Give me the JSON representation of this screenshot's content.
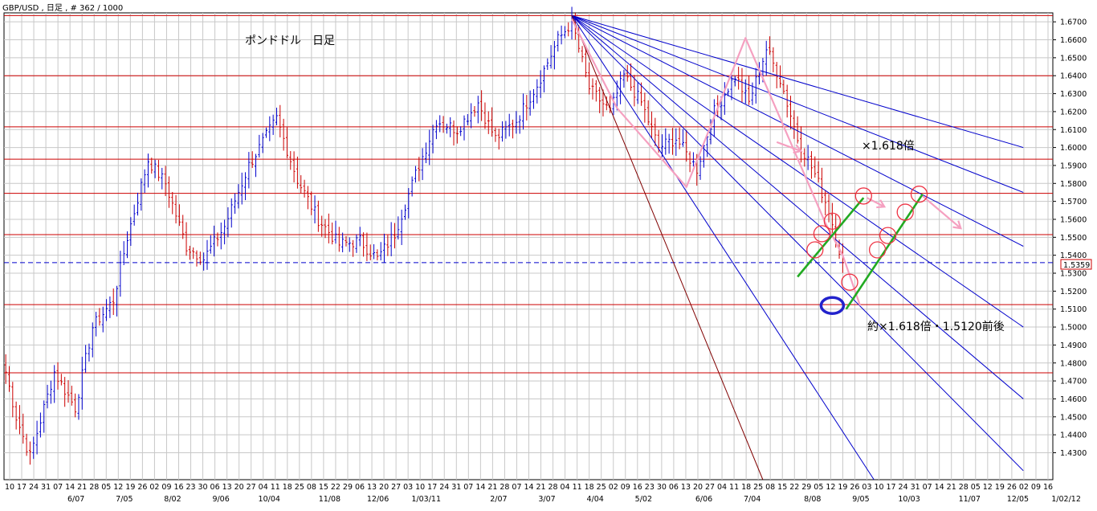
{
  "header": {
    "symbol_info": "GBP/USD , 日足 , # 362 / 1000"
  },
  "chart_title": "ポンドドル　日足",
  "annotations": {
    "fib_upper": "×1.618倍",
    "fib_lower": "約×1.618倍・1.5120前後"
  },
  "last_price_label": "1.5359",
  "colors": {
    "background": "#ffffff",
    "grid": "#c8c8c8",
    "bull": "#0000cc",
    "bear": "#cc0000",
    "fan": "#0000cc",
    "fan_steep": "#800000",
    "zone_lines": "#cc0000",
    "current_price": "#0000cc",
    "pattern": "#f5a0c0",
    "channel": "#22aa22",
    "circle": "#ee3344",
    "target_ring": "#2222cc"
  },
  "chart_data": {
    "type": "candlestick",
    "symbol": "GBP/USD",
    "timeframe": "日足",
    "ylim": [
      1.415,
      1.675
    ],
    "y_ticks": [
      "1.6700",
      "1.6600",
      "1.6500",
      "1.6400",
      "1.6300",
      "1.6200",
      "1.6100",
      "1.6000",
      "1.5900",
      "1.5800",
      "1.5700",
      "1.5600",
      "1.5500",
      "1.5400",
      "1.5300",
      "1.5200",
      "1.5100",
      "1.5000",
      "1.4900",
      "1.4800",
      "1.4700",
      "1.4600",
      "1.4500",
      "1.4400",
      "1.4300"
    ],
    "x_day_labels": [
      "10",
      "17",
      "24",
      "31",
      "07",
      "14",
      "21",
      "28",
      "05",
      "12",
      "19",
      "26",
      "02",
      "09",
      "16",
      "23",
      "30",
      "06",
      "13",
      "20",
      "27",
      "04",
      "11",
      "18",
      "25",
      "08",
      "15",
      "22",
      "29",
      "06",
      "13",
      "20",
      "27",
      "03",
      "10",
      "17",
      "24",
      "31",
      "07",
      "14",
      "21",
      "28",
      "07",
      "14",
      "21",
      "28",
      "04",
      "11",
      "18",
      "25",
      "02",
      "09",
      "16",
      "23",
      "30",
      "06",
      "13",
      "20",
      "27",
      "04",
      "11",
      "18",
      "25",
      "08",
      "15",
      "22",
      "29",
      "05",
      "12",
      "19",
      "26",
      "03",
      "10",
      "17",
      "24",
      "31",
      "07",
      "14",
      "21",
      "28",
      "05",
      "12",
      "19",
      "26",
      "02",
      "09",
      "16"
    ],
    "x_month_labels": [
      "6/07",
      "7/05",
      "8/02",
      "9/06",
      "10/04",
      "11/08",
      "12/06",
      "1/03/11",
      "2/07",
      "3/07",
      "4/04",
      "5/02",
      "6/06",
      "7/04",
      "8/08",
      "9/05",
      "10/03",
      "11/07",
      "12/05",
      "1/02/12"
    ],
    "anchors": [
      {
        "bar": 0,
        "price": 1.475
      },
      {
        "bar": 3,
        "price": 1.45
      },
      {
        "bar": 7,
        "price": 1.428
      },
      {
        "bar": 14,
        "price": 1.475
      },
      {
        "bar": 20,
        "price": 1.455
      },
      {
        "bar": 25,
        "price": 1.5
      },
      {
        "bar": 31,
        "price": 1.515
      },
      {
        "bar": 35,
        "price": 1.55
      },
      {
        "bar": 41,
        "price": 1.593
      },
      {
        "bar": 46,
        "price": 1.58
      },
      {
        "bar": 52,
        "price": 1.545
      },
      {
        "bar": 57,
        "price": 1.538
      },
      {
        "bar": 63,
        "price": 1.556
      },
      {
        "bar": 70,
        "price": 1.59
      },
      {
        "bar": 78,
        "price": 1.616
      },
      {
        "bar": 84,
        "price": 1.582
      },
      {
        "bar": 90,
        "price": 1.56
      },
      {
        "bar": 96,
        "price": 1.546
      },
      {
        "bar": 102,
        "price": 1.548
      },
      {
        "bar": 107,
        "price": 1.538
      },
      {
        "bar": 112,
        "price": 1.552
      },
      {
        "bar": 118,
        "price": 1.585
      },
      {
        "bar": 124,
        "price": 1.615
      },
      {
        "bar": 130,
        "price": 1.61
      },
      {
        "bar": 136,
        "price": 1.625
      },
      {
        "bar": 141,
        "price": 1.605
      },
      {
        "bar": 147,
        "price": 1.615
      },
      {
        "bar": 153,
        "price": 1.635
      },
      {
        "bar": 159,
        "price": 1.66
      },
      {
        "bar": 163,
        "price": 1.67
      },
      {
        "bar": 168,
        "price": 1.633
      },
      {
        "bar": 174,
        "price": 1.62
      },
      {
        "bar": 178,
        "price": 1.64
      },
      {
        "bar": 183,
        "price": 1.625
      },
      {
        "bar": 188,
        "price": 1.6
      },
      {
        "bar": 193,
        "price": 1.605
      },
      {
        "bar": 199,
        "price": 1.588
      },
      {
        "bar": 204,
        "price": 1.62
      },
      {
        "bar": 210,
        "price": 1.64
      },
      {
        "bar": 214,
        "price": 1.625
      },
      {
        "bar": 219,
        "price": 1.655
      },
      {
        "bar": 223,
        "price": 1.638
      },
      {
        "bar": 228,
        "price": 1.605
      },
      {
        "bar": 233,
        "price": 1.585
      },
      {
        "bar": 237,
        "price": 1.565
      },
      {
        "bar": 241,
        "price": 1.5359
      }
    ],
    "zone_lines": [
      1.6735,
      1.64,
      1.6115,
      1.5935,
      1.5745,
      1.5515,
      1.5125,
      1.4745
    ],
    "current_price": 1.5359,
    "fan_origin": {
      "bar": 163,
      "price": 1.6735
    },
    "fan_lines": [
      {
        "end_bar": 293,
        "end_price": 1.6
      },
      {
        "end_bar": 293,
        "end_price": 1.575
      },
      {
        "end_bar": 293,
        "end_price": 1.545
      },
      {
        "end_bar": 293,
        "end_price": 1.5
      },
      {
        "end_bar": 293,
        "end_price": 1.46
      },
      {
        "end_bar": 293,
        "end_price": 1.42
      },
      {
        "end_bar": 250,
        "end_price": 1.415
      }
    ],
    "fan_steep": {
      "end_bar": 218,
      "end_price": 1.415
    },
    "pattern_path": [
      {
        "bar": 163,
        "price": 1.6715
      },
      {
        "bar": 176,
        "price": 1.622
      },
      {
        "bar": 196,
        "price": 1.578
      },
      {
        "bar": 213,
        "price": 1.661
      },
      {
        "bar": 236,
        "price": 1.558
      },
      {
        "bar": 241,
        "price": 1.54
      },
      {
        "bar": 246,
        "price": 1.512
      }
    ],
    "pattern_upper_arrow": [
      {
        "bar": 222,
        "price": 1.603
      },
      {
        "bar": 229,
        "price": 1.598
      }
    ],
    "channels": [
      {
        "from": {
          "bar": 228,
          "price": 1.528
        },
        "to": {
          "bar": 247,
          "price": 1.572
        }
      },
      {
        "from": {
          "bar": 242,
          "price": 1.51
        },
        "to": {
          "bar": 264,
          "price": 1.574
        }
      }
    ],
    "circles": [
      {
        "bar": 233,
        "price": 1.543
      },
      {
        "bar": 235,
        "price": 1.552
      },
      {
        "bar": 238,
        "price": 1.559
      },
      {
        "bar": 243,
        "price": 1.525
      },
      {
        "bar": 247,
        "price": 1.573
      },
      {
        "bar": 251,
        "price": 1.543
      },
      {
        "bar": 254,
        "price": 1.551
      },
      {
        "bar": 259,
        "price": 1.564
      },
      {
        "bar": 263,
        "price": 1.574
      }
    ],
    "target": {
      "bar": 238,
      "price": 1.512
    },
    "arrows": [
      {
        "from": {
          "bar": 248,
          "price": 1.572
        },
        "to": {
          "bar": 253,
          "price": 1.567
        }
      },
      {
        "from": {
          "bar": 264,
          "price": 1.573
        },
        "to": {
          "bar": 275,
          "price": 1.555
        }
      }
    ]
  }
}
